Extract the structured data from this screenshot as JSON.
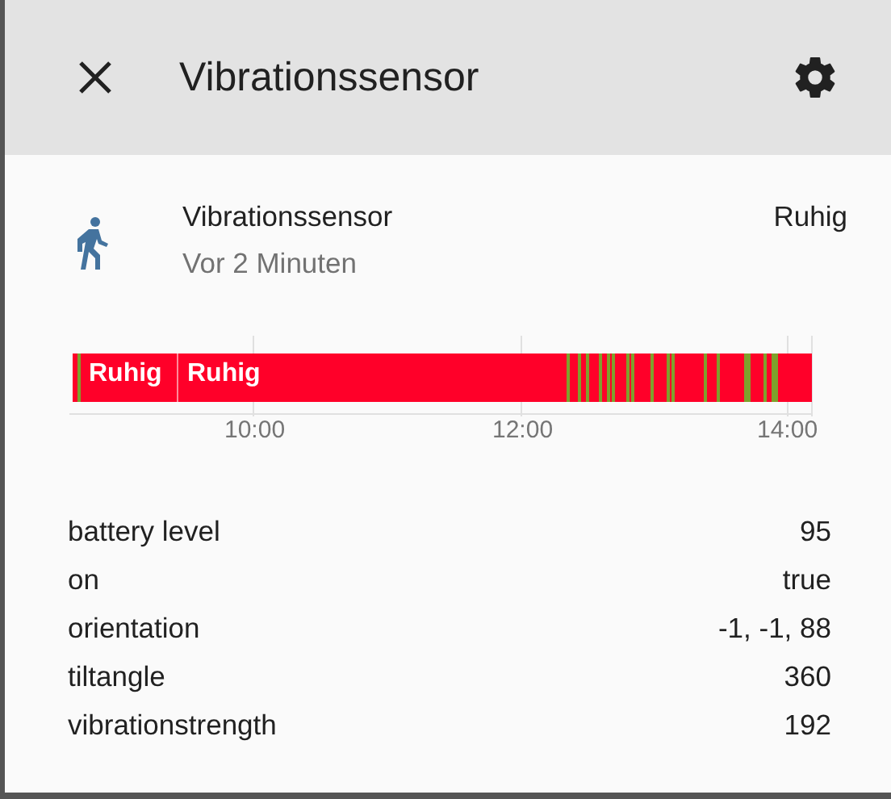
{
  "dialog": {
    "title": "Vibrationssensor"
  },
  "entity": {
    "name": "Vibrationssensor",
    "last_changed": "Vor 2 Minuten",
    "state": "Ruhig"
  },
  "timeline": {
    "segment_labels": [
      "Ruhig",
      "Ruhig"
    ],
    "ticks": [
      "10:00",
      "12:00",
      "14:00"
    ]
  },
  "attributes": [
    {
      "name": "battery level",
      "value": "95"
    },
    {
      "name": "on",
      "value": "true"
    },
    {
      "name": "orientation",
      "value": "-1, -1, 88"
    },
    {
      "name": "tiltangle",
      "value": "360"
    },
    {
      "name": "vibrationstrength",
      "value": "192"
    }
  ]
}
